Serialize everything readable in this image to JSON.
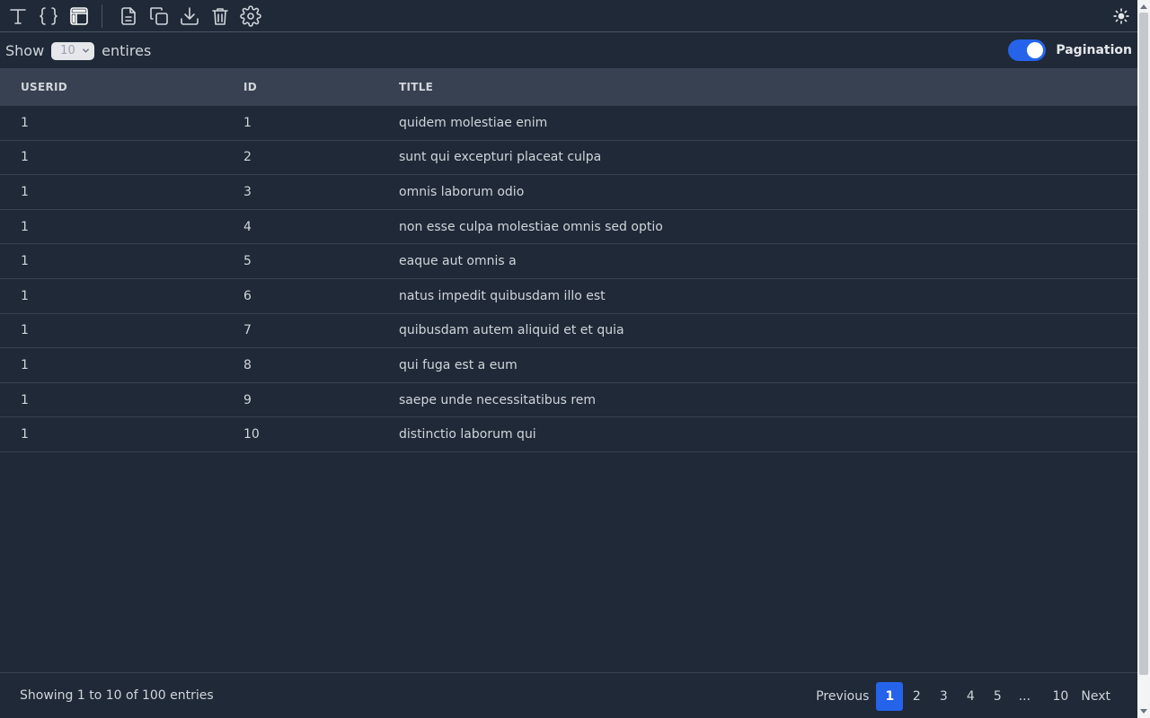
{
  "toolbar": {
    "buttons": [
      {
        "icon": "text-icon"
      },
      {
        "icon": "braces-icon"
      },
      {
        "icon": "table-icon",
        "active": true
      },
      {
        "icon": "file-icon"
      },
      {
        "icon": "copy-icon"
      },
      {
        "icon": "download-icon"
      },
      {
        "icon": "trash-icon"
      },
      {
        "icon": "gear-icon"
      }
    ],
    "theme_icon": "sun-icon"
  },
  "controls": {
    "show_label": "Show",
    "entries_value": "10",
    "entries_label": "entires",
    "pagination_label": "Pagination",
    "pagination_enabled": true
  },
  "table": {
    "headers": [
      "USERID",
      "ID",
      "TITLE"
    ],
    "rows": [
      [
        "1",
        "1",
        "quidem molestiae enim"
      ],
      [
        "1",
        "2",
        "sunt qui excepturi placeat culpa"
      ],
      [
        "1",
        "3",
        "omnis laborum odio"
      ],
      [
        "1",
        "4",
        "non esse culpa molestiae omnis sed optio"
      ],
      [
        "1",
        "5",
        "eaque aut omnis a"
      ],
      [
        "1",
        "6",
        "natus impedit quibusdam illo est"
      ],
      [
        "1",
        "7",
        "quibusdam autem aliquid et et quia"
      ],
      [
        "1",
        "8",
        "qui fuga est a eum"
      ],
      [
        "1",
        "9",
        "saepe unde necessitatibus rem"
      ],
      [
        "1",
        "10",
        "distinctio laborum qui"
      ]
    ]
  },
  "footer": {
    "showing_text": "Showing 1 to 10 of 100 entries",
    "previous_label": "Previous",
    "next_label": "Next",
    "pages": [
      "1",
      "2",
      "3",
      "4",
      "5",
      "...",
      "10"
    ],
    "current_page": "1"
  },
  "colors": {
    "background": "#1f2937",
    "header_bg": "#374151",
    "accent": "#2563eb"
  }
}
